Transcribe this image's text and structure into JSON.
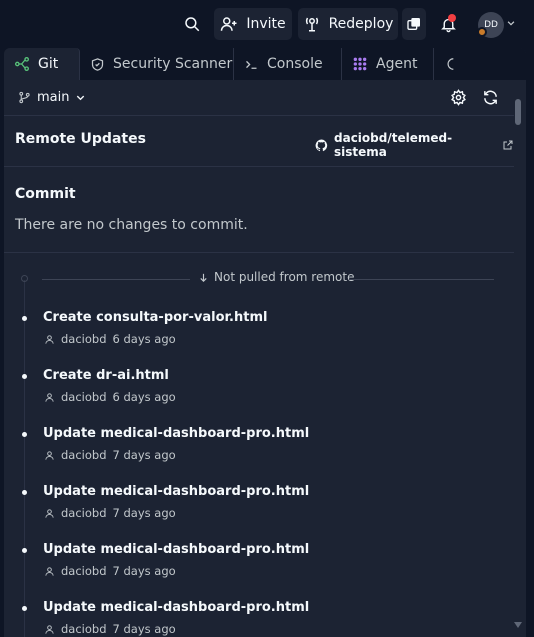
{
  "topbar": {
    "invite_label": "Invite",
    "redeploy_label": "Redeploy",
    "avatar_initials": "DD",
    "icons": [
      "search-icon",
      "invite-icon",
      "redeploy-icon",
      "new-tab-icon",
      "bell-icon",
      "chevron-down-icon"
    ]
  },
  "tabs": [
    {
      "label": "Git",
      "icon": "git-icon",
      "active": true
    },
    {
      "label": "Security Scanner",
      "icon": "shield-icon",
      "active": false
    },
    {
      "label": "Console",
      "icon": "terminal-icon",
      "active": false
    },
    {
      "label": "Agent",
      "icon": "agent-icon",
      "active": false
    }
  ],
  "branch": {
    "name": "main"
  },
  "remote": {
    "title": "Remote Updates",
    "repo": "daciobd/telemed-sistema"
  },
  "commit_section": {
    "title": "Commit",
    "empty_text": "There are no changes to commit."
  },
  "history": {
    "divider_label": "Not pulled from remote",
    "commits": [
      {
        "message": "Create consulta-por-valor.html",
        "author": "daciobd",
        "time": "6 days ago"
      },
      {
        "message": "Create dr-ai.html",
        "author": "daciobd",
        "time": "6 days ago"
      },
      {
        "message": "Update medical-dashboard-pro.html",
        "author": "daciobd",
        "time": "7 days ago"
      },
      {
        "message": "Update medical-dashboard-pro.html",
        "author": "daciobd",
        "time": "7 days ago"
      },
      {
        "message": "Update medical-dashboard-pro.html",
        "author": "daciobd",
        "time": "7 days ago"
      },
      {
        "message": "Update medical-dashboard-pro.html",
        "author": "daciobd",
        "time": "7 days ago"
      }
    ]
  },
  "colors": {
    "background": "#0e1525",
    "panel": "#1c2333",
    "accent_green": "#58c27a",
    "notification": "#f23f42",
    "agent_purple": "#a97cf0"
  }
}
